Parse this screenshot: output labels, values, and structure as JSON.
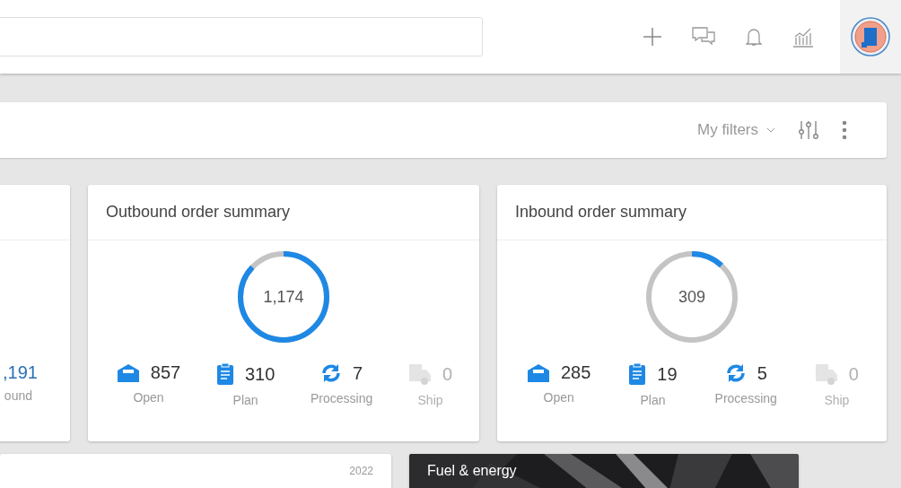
{
  "header": {
    "actions": [
      {
        "kind": "add"
      },
      {
        "kind": "chat"
      },
      {
        "kind": "bell"
      },
      {
        "kind": "chart"
      }
    ]
  },
  "filter_bar": {
    "my_filters": "My filters"
  },
  "cards": [
    {
      "kind": "partial",
      "value": ",191",
      "label": "ound"
    },
    {
      "kind": "summary",
      "title": "Outbound order summary",
      "total": "1,174",
      "level": 0.87,
      "metrics": [
        {
          "kind": "open",
          "value": "857",
          "label": "Open",
          "disabled": false
        },
        {
          "kind": "plan",
          "value": "310",
          "label": "Plan",
          "disabled": false
        },
        {
          "kind": "processing",
          "value": "7",
          "label": "Processing",
          "disabled": false
        },
        {
          "kind": "ship",
          "value": "0",
          "label": "Ship",
          "disabled": true
        }
      ]
    },
    {
      "kind": "summary",
      "title": "Inbound order summary",
      "total": "309",
      "level": 0.12,
      "metrics": [
        {
          "kind": "open",
          "value": "285",
          "label": "Open",
          "disabled": false
        },
        {
          "kind": "plan",
          "value": "19",
          "label": "Plan",
          "disabled": false
        },
        {
          "kind": "processing",
          "value": "5",
          "label": "Processing",
          "disabled": false
        },
        {
          "kind": "ship",
          "value": "0",
          "label": "Ship",
          "disabled": true
        }
      ]
    }
  ],
  "bottom_cards": [
    {
      "kind": "plain",
      "year": "2022"
    },
    {
      "kind": "picture",
      "title": "Fuel & energy"
    }
  ]
}
